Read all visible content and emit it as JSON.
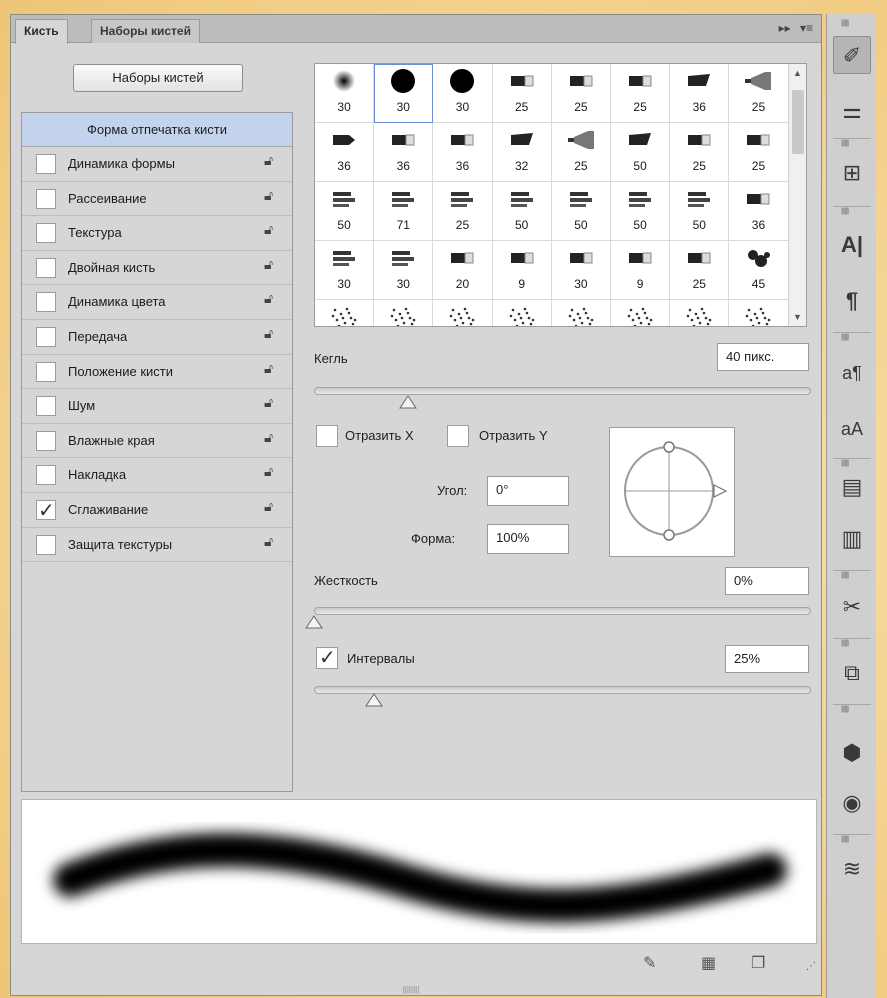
{
  "tabs": [
    {
      "label": "Кисть",
      "active": true
    },
    {
      "label": "Наборы кистей",
      "active": false
    }
  ],
  "tab_controls": {
    "expand": "▸▸",
    "menu": "▾≡"
  },
  "presets_button": "Наборы кистей",
  "sidebar": {
    "header": "Форма отпечатка кисти",
    "items": [
      {
        "label": "Динамика формы",
        "checked": false
      },
      {
        "label": "Рассеивание",
        "checked": false
      },
      {
        "label": "Текстура",
        "checked": false
      },
      {
        "label": "Двойная кисть",
        "checked": false
      },
      {
        "label": "Динамика цвета",
        "checked": false
      },
      {
        "label": "Передача",
        "checked": false
      },
      {
        "label": "Положение кисти",
        "checked": false
      },
      {
        "label": "Шум",
        "checked": false
      },
      {
        "label": "Влажные края",
        "checked": false
      },
      {
        "label": "Накладка",
        "checked": false
      },
      {
        "label": "Сглаживание",
        "checked": true
      },
      {
        "label": "Защита текстуры",
        "checked": false
      }
    ]
  },
  "brushes": {
    "rows": [
      [
        "30",
        "30",
        "30",
        "25",
        "25",
        "25",
        "36",
        "25"
      ],
      [
        "36",
        "36",
        "36",
        "32",
        "25",
        "50",
        "25",
        "25"
      ],
      [
        "50",
        "71",
        "25",
        "50",
        "50",
        "50",
        "50",
        "36"
      ],
      [
        "30",
        "30",
        "20",
        "9",
        "30",
        "9",
        "25",
        "45"
      ]
    ],
    "icons": [
      [
        "soft-round",
        "hard-round",
        "hard-round",
        "bristle-flat",
        "bristle-flat",
        "bristle-flat",
        "bristle-angle",
        "bristle-fan"
      ],
      [
        "bristle-point",
        "bristle-flat",
        "bristle-flat",
        "bristle-angle",
        "bristle-fan",
        "bristle-angle",
        "bristle-flat",
        "bristle-flat"
      ],
      [
        "airbrush",
        "airbrush",
        "airbrush",
        "airbrush",
        "airbrush",
        "airbrush",
        "airbrush",
        "bristle-flat"
      ],
      [
        "airbrush",
        "airbrush",
        "bristle-flat",
        "bristle-flat",
        "bristle-flat",
        "bristle-flat",
        "bristle-flat",
        "splatter"
      ],
      [
        "spatter",
        "spatter",
        "spatter",
        "spatter",
        "spatter",
        "spatter",
        "spatter",
        "spatter"
      ]
    ]
  },
  "size": {
    "label": "Кегль",
    "value": "40 пикс.",
    "fraction": 0.19
  },
  "flip_x": {
    "label": "Отразить X",
    "checked": false
  },
  "flip_y": {
    "label": "Отразить Y",
    "checked": false
  },
  "angle": {
    "label": "Угол:",
    "value": "0°"
  },
  "roundness": {
    "label": "Форма:",
    "value": "100%"
  },
  "hardness": {
    "label": "Жесткость",
    "value": "0%",
    "fraction": 0.0
  },
  "spacing": {
    "label": "Интервалы",
    "value": "25%",
    "checked": true,
    "fraction": 0.12
  },
  "dock_icons": [
    "brush-icon",
    "brush-presets-icon",
    "clone-source-icon",
    "character-icon",
    "paragraph-icon",
    "character-styles-icon",
    "paragraph-styles-icon",
    "notes-icon",
    "glyphs-icon",
    "tools-icon",
    "3d-icon",
    "materials-icon",
    "layers-icon"
  ],
  "colors": {
    "sidebar_header": "#c3d3ee",
    "panel": "#d6d6d6"
  }
}
